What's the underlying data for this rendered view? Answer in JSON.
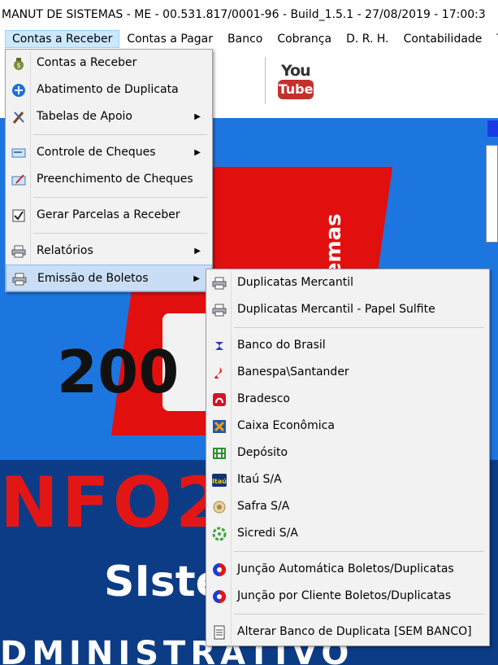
{
  "title": "MANUT DE SISTEMAS - ME - 00.531.817/0001-96 - Build_1.5.1 - 27/08/2019 - 17:00:3",
  "menubar": [
    "Contas a Receber",
    "Contas a Pagar",
    "Banco",
    "Cobrança",
    "D. R. H.",
    "Contabilidade",
    "T"
  ],
  "youtube": {
    "you": "You",
    "tube": "Tube"
  },
  "background": {
    "vertical_text": "stemas",
    "num": "200",
    "big": "NFO2",
    "sist": "SIste",
    "bottom": "DMINISTRATIVO"
  },
  "menu_contas_receber": [
    {
      "label": "Contas a Receber",
      "icon": "money-bag-icon"
    },
    {
      "label": "Abatimento de Duplicata",
      "icon": "plus-circle-icon"
    },
    {
      "label": "Tabelas de Apoio",
      "icon": "tools-icon",
      "submenu": true
    },
    {
      "label": "Controle de Cheques",
      "icon": "check-card-icon",
      "submenu": true
    },
    {
      "label": "Preenchimento de Cheques",
      "icon": "check-write-icon"
    },
    {
      "label": "Gerar Parcelas a Receber",
      "icon": "checkbox-icon"
    },
    {
      "label": "Relatórios",
      "icon": "printer-icon",
      "submenu": true
    },
    {
      "label": "Emissão de Boletos",
      "icon": "printer-icon",
      "submenu": true
    }
  ],
  "menu_boletos": [
    {
      "label": "Duplicatas Mercantil",
      "icon": "printer-icon"
    },
    {
      "label": "Duplicatas Mercantil - Papel Sulfite",
      "icon": "printer-icon"
    },
    {
      "label": "Banco do Brasil",
      "icon": "banco-do-brasil-icon"
    },
    {
      "label": "Banespa\\Santander",
      "icon": "santander-icon"
    },
    {
      "label": "Bradesco",
      "icon": "bradesco-icon"
    },
    {
      "label": "Caixa Econômica",
      "icon": "caixa-icon"
    },
    {
      "label": "Depósito",
      "icon": "deposit-icon"
    },
    {
      "label": "Itaú S/A",
      "icon": "itau-icon"
    },
    {
      "label": "Safra S/A",
      "icon": "safra-icon"
    },
    {
      "label": "Sicredi S/A",
      "icon": "sicredi-icon"
    },
    {
      "label": "Junção Automática Boletos/Duplicatas",
      "icon": "merge-icon"
    },
    {
      "label": "Junção por Cliente Boletos/Duplicatas",
      "icon": "merge-icon"
    },
    {
      "label": "Alterar Banco de Duplicata [SEM BANCO]",
      "icon": "document-icon"
    }
  ],
  "colors": {
    "highlight": "#c9def5",
    "menubar_active": "#cce8ff",
    "background_blue": "#1d76e0",
    "logo_red": "#e20f0f"
  }
}
